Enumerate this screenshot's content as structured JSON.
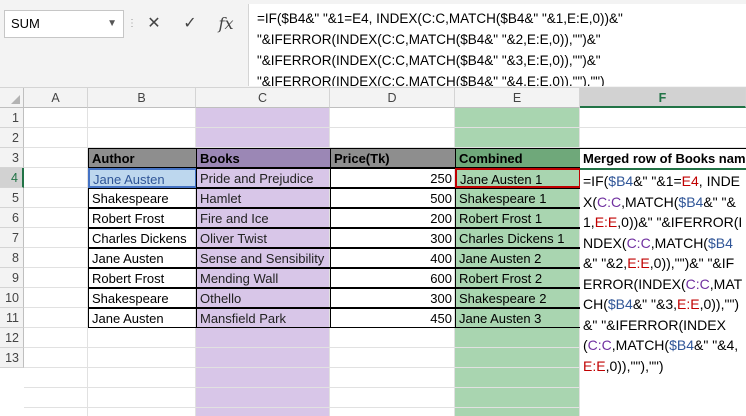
{
  "name_box": {
    "value": "SUM"
  },
  "formula_bar": {
    "cancel_label": "✕",
    "enter_label": "✓",
    "fx_label": "fx",
    "formula": "=IF($B4&\" \"&1=E4, INDEX(C:C,MATCH($B4&\" \"&1,E:E,0))&\" \"&IFERROR(INDEX(C:C,MATCH($B4&\" \"&2,E:E,0)),\"\")&\" \"&IFERROR(INDEX(C:C,MATCH($B4&\" \"&3,E:E,0)),\"\")&\" \"&IFERROR(INDEX(C:C,MATCH($B4&\" \"&4,E:E,0)),\"\"),\"\")"
  },
  "columns": [
    "A",
    "B",
    "C",
    "D",
    "E",
    "F"
  ],
  "rows": [
    "1",
    "2",
    "3",
    "4",
    "5",
    "6",
    "7",
    "8",
    "9",
    "10",
    "11",
    "12",
    "13"
  ],
  "table": {
    "headers": {
      "author": "Author",
      "books": "Books",
      "price": "Price(Tk)",
      "combined": "Combined",
      "merged": "Merged row of Books nam"
    },
    "rows": [
      {
        "author": "Jane Austen",
        "book": "Pride and Prejudice",
        "price": "250",
        "combined": "Jane Austen 1"
      },
      {
        "author": "Shakespeare",
        "book": "Hamlet",
        "price": "500",
        "combined": "Shakespeare 1"
      },
      {
        "author": "Robert Frost",
        "book": "Fire and Ice",
        "price": "200",
        "combined": "Robert Frost 1"
      },
      {
        "author": "Charles Dickens",
        "book": "Oliver Twist",
        "price": "300",
        "combined": "Charles Dickens  1"
      },
      {
        "author": "Jane Austen",
        "book": "Sense and Sensibility",
        "price": "400",
        "combined": "Jane Austen 2"
      },
      {
        "author": "Robert Frost",
        "book": "Mending Wall",
        "price": "600",
        "combined": "Robert Frost 2"
      },
      {
        "author": "Shakespeare",
        "book": "Othello",
        "price": "300",
        "combined": "Shakespeare 2"
      },
      {
        "author": "Jane Austen",
        "book": "Mansfield Park",
        "price": "450",
        "combined": "Jane Austen 3"
      }
    ]
  },
  "editing_cell": {
    "parts": [
      {
        "t": "=IF(",
        "c": ""
      },
      {
        "t": "$B4",
        "c": "b"
      },
      {
        "t": "&\" \"&1=",
        "c": ""
      },
      {
        "t": "E4",
        "c": "e"
      },
      {
        "t": ", INDEX(",
        "c": ""
      },
      {
        "t": "C:C",
        "c": "c"
      },
      {
        "t": ",MATCH(",
        "c": ""
      },
      {
        "t": "$B4",
        "c": "b"
      },
      {
        "t": "&\" \"&1,",
        "c": ""
      },
      {
        "t": "E:E",
        "c": "e"
      },
      {
        "t": ",0))&\" \"&IFERROR(INDEX(",
        "c": ""
      },
      {
        "t": "C:C",
        "c": "c"
      },
      {
        "t": ",MATCH(",
        "c": ""
      },
      {
        "t": "$B4",
        "c": "b"
      },
      {
        "t": "&\" \"&2,",
        "c": ""
      },
      {
        "t": "E:E",
        "c": "e"
      },
      {
        "t": ",0)),\"\")&\" \"&IFERROR(INDEX(",
        "c": ""
      },
      {
        "t": "C:C",
        "c": "c"
      },
      {
        "t": ",MATCH(",
        "c": ""
      },
      {
        "t": "$B4",
        "c": "b"
      },
      {
        "t": "&\" \"&3,",
        "c": ""
      },
      {
        "t": "E:E",
        "c": "e"
      },
      {
        "t": ",0)),\"\")&\" \"&IFERROR(INDEX(",
        "c": ""
      },
      {
        "t": "C:C",
        "c": "c"
      },
      {
        "t": ",MATCH(",
        "c": ""
      },
      {
        "t": "$B4",
        "c": "b"
      },
      {
        "t": "&\" \"&4,",
        "c": ""
      },
      {
        "t": "E:E",
        "c": "e"
      },
      {
        "t": ",0)),\"\"),\"\")",
        "c": ""
      }
    ]
  },
  "colors": {
    "purple_fill": "#d8c6e8",
    "green_fill": "#a9d5b0",
    "header_fill": "#8e8e8e",
    "active_green": "#217346"
  }
}
